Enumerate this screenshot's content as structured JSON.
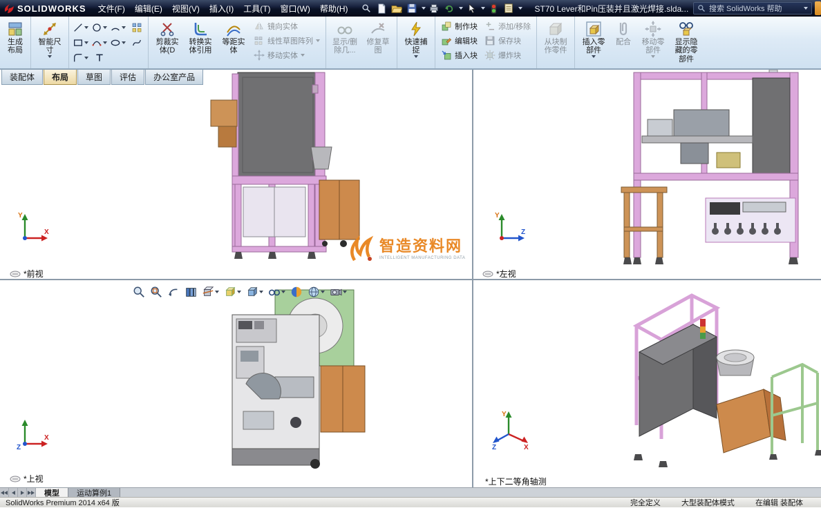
{
  "colors": {
    "watermark_orange": "#e8831c",
    "machine_pink": "#dca8dc",
    "machine_tan": "#cd8a4c",
    "machine_green": "#a8d09c",
    "machine_gray": "#707072",
    "titlebar_dark": "#0a1226"
  },
  "title_bar": {
    "logo": "SOLIDWORKS",
    "menus": [
      "文件(F)",
      "编辑(E)",
      "视图(V)",
      "插入(I)",
      "工具(T)",
      "窗口(W)",
      "帮助(H)"
    ],
    "document_title": "ST70 Lever和Pin压装并且激光焊接.slda...",
    "search_text": "搜索 SolidWorks 帮助"
  },
  "ribbon": {
    "create_layout": "生成布局",
    "smart_dimension": "智能尺寸",
    "trim_entities": "剪裁实体(D",
    "convert_entities": "转换实体引用",
    "offset_entities": "等距实体",
    "mirror_entities": "镜向实体",
    "linear_pattern": "线性草图阵列",
    "move_entities": "移动实体",
    "display_delete": "显示/删除几...",
    "repair_sketch": "修复草图",
    "quick_snaps": "快速捕捉",
    "make_block": "制作块",
    "edit_block": "编辑块",
    "insert_block": "插入块",
    "add_remove": "添加/移除",
    "save_block": "保存块",
    "explode_block": "爆炸块",
    "make_part_from_block": "从块制作零件",
    "insert_components": "插入零部件",
    "mate": "配合",
    "move_component": "移动零部件",
    "show_hidden": "显示隐藏的零部件"
  },
  "command_tabs": [
    {
      "label": "装配体",
      "active": false
    },
    {
      "label": "布局",
      "active": true
    },
    {
      "label": "草图",
      "active": false
    },
    {
      "label": "评估",
      "active": false
    },
    {
      "label": "办公室产品",
      "active": false
    }
  ],
  "viewport": {
    "pane_labels": {
      "front": "*前视",
      "left": "*左视",
      "top": "*上视",
      "iso": "*上下二等角轴测"
    },
    "axes": {
      "x": "X",
      "y": "Y",
      "z": "Z"
    },
    "watermark": {
      "title": "智造资料网",
      "subtitle": "INTELLIGENT MANUFACTURING DATA"
    }
  },
  "model_bar": {
    "tabs": [
      {
        "label": "模型",
        "active": true
      },
      {
        "label": "运动算例1",
        "active": false
      }
    ]
  },
  "status_bar": {
    "product": "SolidWorks Premium 2014 x64 版",
    "define_state": "完全定义",
    "mode": "大型装配体模式",
    "editing": "在编辑 装配体"
  }
}
